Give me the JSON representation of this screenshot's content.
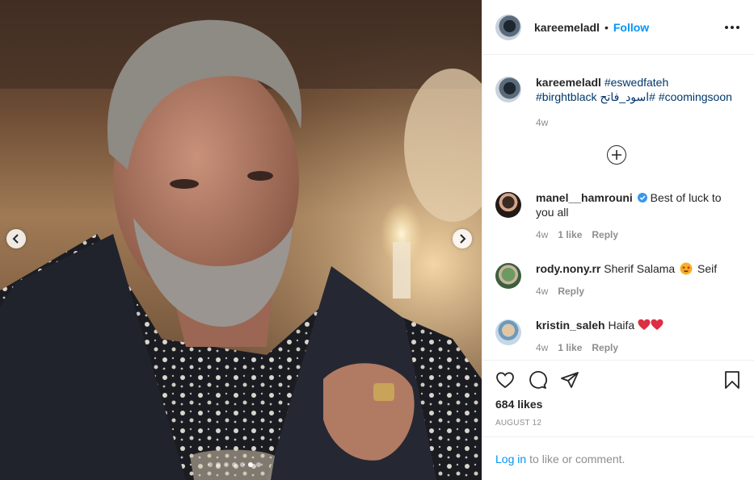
{
  "post": {
    "owner": "kareemeladl",
    "separator": "•",
    "follow_label": "Follow",
    "more_icon": "more-options-icon"
  },
  "caption": {
    "username": "kareemeladl",
    "tags": [
      "#eswedfateh",
      "#birghtblack",
      "#اسود_فاتح",
      "#coomingsoon"
    ],
    "age": "4w"
  },
  "comments": [
    {
      "username": "manel__hamrouni",
      "verified": true,
      "text": "Best of luck to you all",
      "age": "4w",
      "likes": "1 like",
      "reply": "Reply"
    },
    {
      "username": "rody.nony.rr",
      "text_before": "Sherif Salama",
      "emoji": "star-struck-emoji",
      "text_after": "Seif",
      "age": "4w",
      "reply": "Reply"
    },
    {
      "username": "kristin_saleh",
      "text": "Haifa",
      "emoji": "red-heart-emoji",
      "age": "4w",
      "likes": "1 like",
      "reply": "Reply"
    }
  ],
  "actions": {
    "likes": "684 likes",
    "date": "AUGUST 12"
  },
  "login": {
    "link": "Log in",
    "rest": "to like or comment."
  },
  "carousel": {
    "slide_count": 7,
    "active_index": 5
  },
  "colors": {
    "accent": "#0095f6",
    "hashtag": "#00376b",
    "muted": "#8e8e8e",
    "verified": "#3897f0",
    "heart": "#ed4956"
  }
}
